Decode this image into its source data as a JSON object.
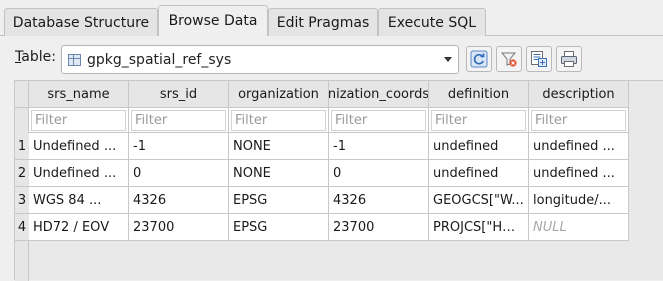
{
  "tabs": [
    {
      "label": "Database Structure",
      "active": false
    },
    {
      "label": "Browse Data",
      "active": true
    },
    {
      "label": "Edit Pragmas",
      "active": false
    },
    {
      "label": "Execute SQL",
      "active": false
    }
  ],
  "toolbar": {
    "table_label_prefix": "T",
    "table_label_rest": "able:",
    "table_value": "gpkg_spatial_ref_sys",
    "buttons": [
      "refresh-icon",
      "clear-filters-icon",
      "save-filter-icon",
      "print-icon"
    ]
  },
  "grid": {
    "columns": [
      "srs_name",
      "srs_id",
      "organization",
      "nization_coords",
      "definition",
      "description"
    ],
    "filter_placeholder": "Filter",
    "rows": [
      {
        "num": "1",
        "cells": [
          "Undefined ...",
          "-1",
          "NONE",
          "-1",
          "undefined",
          "undefined ..."
        ]
      },
      {
        "num": "2",
        "cells": [
          "Undefined ...",
          "0",
          "NONE",
          "0",
          "undefined",
          "undefined ..."
        ]
      },
      {
        "num": "3",
        "cells": [
          "WGS 84 ...",
          "4326",
          "EPSG",
          "4326",
          "GEOGCS[\"W...",
          "longitude/..."
        ]
      },
      {
        "num": "4",
        "cells": [
          "HD72 / EOV",
          "23700",
          "EPSG",
          "23700",
          "PROJCS[\"HD...",
          "NULL"
        ]
      }
    ]
  },
  "colors": {
    "accent_refresh": "#3a76c4",
    "null_text": "#a8a8a8"
  }
}
